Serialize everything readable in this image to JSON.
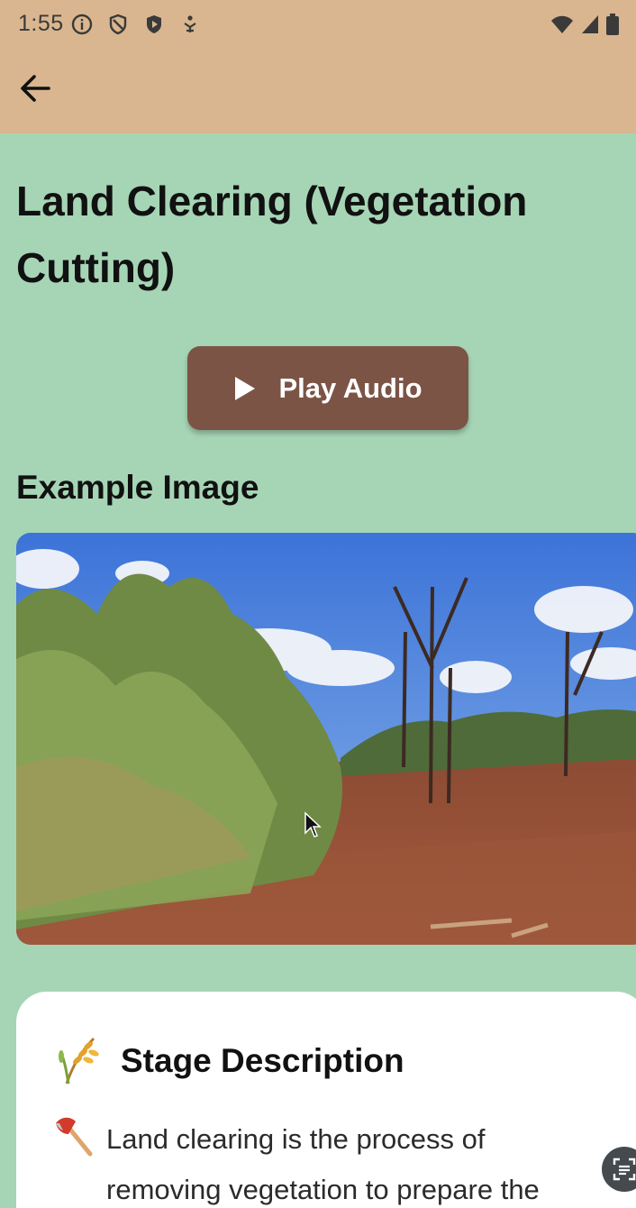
{
  "status_bar": {
    "time": "1:55",
    "left_icons": [
      "info-icon",
      "shield-icon",
      "shield-play-icon",
      "accessibility-icon"
    ],
    "right_icons": [
      "wifi-icon",
      "signal-icon",
      "battery-icon"
    ]
  },
  "appbar": {
    "back_icon": "arrow-left-icon",
    "color": "#d9b68f"
  },
  "page": {
    "title": "Land Clearing (Vegetation Cutting)",
    "background": "#a6d5b6"
  },
  "audio_button": {
    "icon": "play-icon",
    "label": "Play Audio",
    "color": "#7b5446"
  },
  "example": {
    "heading": "Example Image",
    "image_desc": "photo-of-cleared-land"
  },
  "stage_card": {
    "heading_icon": "wheat-icon",
    "heading": "Stage Description",
    "text_icon": "axe-icon",
    "text": "Land clearing is the process of removing vegetation to prepare the"
  },
  "overlay": {
    "fab_icon": "scan-text-icon"
  }
}
